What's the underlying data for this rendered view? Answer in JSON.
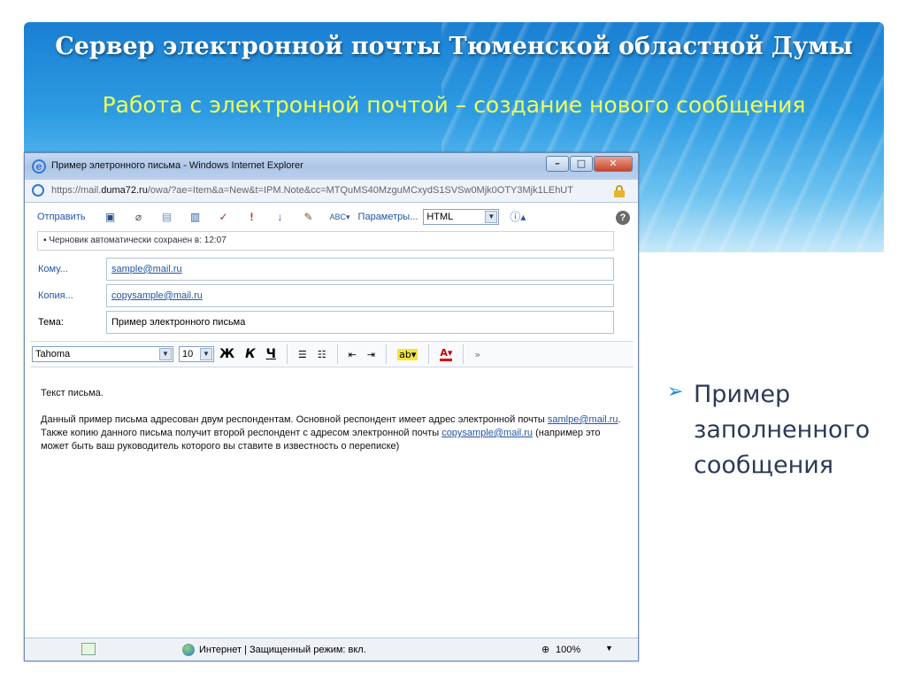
{
  "slide": {
    "title": "Сервер электронной почты Тюменской областной Думы",
    "subtitle": "Работа с электронной почтой – создание нового сообщения",
    "bullet": "Пример заполненного сообщения"
  },
  "window": {
    "title": "Пример элетронного письма - Windows Internet Explorer",
    "address_prefix": "https://mail.",
    "address_host": "duma72.ru",
    "address_rest": "/owa/?ae=Item&a=New&t=IPM.Note&cc=MTQuMS40MzguMCxydS1SVSw0Mjk0OTY3Mjk1LEhUT"
  },
  "toolbar": {
    "send": "Отправить",
    "params": "Параметры...",
    "format": "HTML"
  },
  "draft_notice": "Черновик автоматически сохранен в: 12:07",
  "fields": {
    "to_label": "Кому...",
    "to_value": "sample@mail.ru",
    "cc_label": "Копия...",
    "cc_value": "copysample@mail.ru",
    "subject_label": "Тема:",
    "subject_value": "Пример электронного письма"
  },
  "format_bar": {
    "font": "Tahoma",
    "size": "10",
    "bold": "Ж",
    "italic": "К",
    "underline": "Ч"
  },
  "message": {
    "line1": "Текст письма.",
    "para_start": "Данный пример письма адресован двум респондентам. Основной респондент имеет адрес электронной почты",
    "link1": "samlpe@mail.ru",
    "para_mid": ". Также копию данного письма получит второй респондент с адресом электронной почты",
    "link2": "copysample@mail.ru",
    "para_end": " (например это может быть ваш руководитель которого вы ставите в известность о переписке)"
  },
  "status": {
    "zone": "Интернет | Защищенный режим: вкл.",
    "zoom": "100%"
  }
}
